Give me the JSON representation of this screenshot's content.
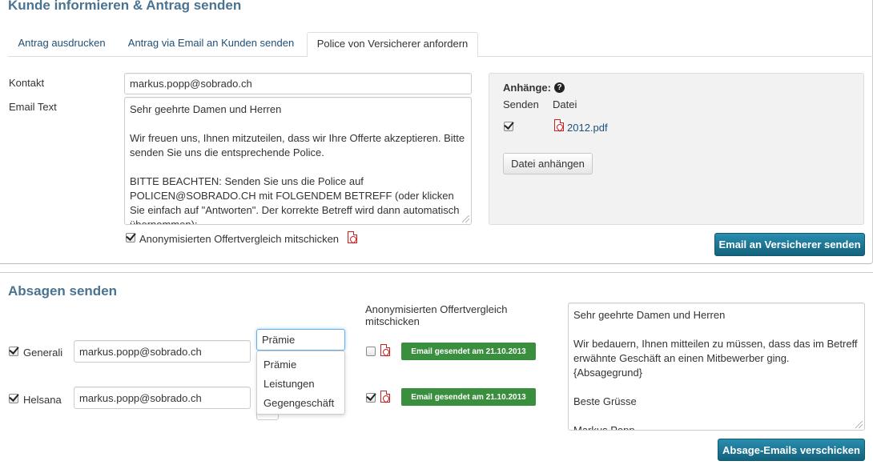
{
  "section1": {
    "title": "Kunde informieren & Antrag senden",
    "tabs": [
      {
        "label": "Antrag ausdrucken"
      },
      {
        "label": "Antrag via Email an Kunden senden"
      },
      {
        "label": "Police von Versicherer anfordern"
      }
    ],
    "contact_label": "Kontakt",
    "contact_value": "markus.popp@sobrado.ch",
    "email_text_label": "Email Text",
    "email_text": "Sehr geehrte Damen und Herren\n\nWir freuen uns, Ihnen mitzuteilen, dass wir Ihre Offerte akzeptieren. Bitte senden Sie uns die entsprechende Police.\n\nBITTE BEACHTEN: Senden Sie uns die Police auf POLICEN@SOBRADO.CH mit FOLGENDEM BETREFF (oder klicken Sie einfach auf \"Antworten\". Der korrekte Betreff wird dann automatisch übernommen):",
    "anon_label": "Anonymisierten Offertvergleich mitschicken",
    "attachments": {
      "title": "Anhänge:",
      "col_send": "Senden",
      "col_file": "Datei",
      "file_name": "2012.pdf",
      "attach_button": "Datei anhängen"
    },
    "send_button": "Email an Versicherer senden"
  },
  "section2": {
    "title": "Absagen senden",
    "anon_header": "Anonymisierten Offertvergleich mitschicken",
    "rows": [
      {
        "insurer": "Generali",
        "email": "markus.popp@sobrado.ch",
        "badge": "Email gesendet am 21.10.2013"
      },
      {
        "insurer": "Helsana",
        "email": "markus.popp@sobrado.ch",
        "badge": "Email gesendet am 21.10.2013"
      }
    ],
    "reason_selected": "Prämie",
    "reason_options": [
      "Prämie",
      "Leistungen",
      "Gegengeschäft"
    ],
    "rejection_text": "Sehr geehrte Damen und Herren\n\nWir bedauern, Ihnen mitteilen zu müssen, dass das im Betreff erwähnte Geschäft an einen Mitbewerber ging.\n{Absagegrund}\n\nBeste Grüsse\n\nMarkus Popp",
    "send_button": "Absage-Emails verschicken"
  },
  "colors": {
    "heading": "#4a7391",
    "link": "#1f4f77",
    "primary_button": "#1a7394",
    "success_badge": "#3a8f3e",
    "pdf_icon": "#cc1f1f"
  },
  "icons": [
    "pdf-icon",
    "help-icon",
    "checkbox-checked-icon",
    "resize-grip-icon"
  ]
}
